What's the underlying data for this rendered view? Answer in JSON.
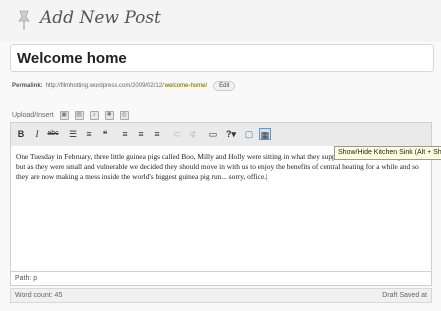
{
  "header": {
    "title": "Add New Post",
    "icon": "pushpin-icon"
  },
  "post": {
    "title": "Welcome home",
    "permalink_label": "Permalink:",
    "permalink_url": "http://filmhotting.wordpress.com/2009/02/12/",
    "permalink_slug": "welcome-home/",
    "edit_label": "Edit"
  },
  "upload": {
    "label": "Upload/Insert",
    "icons": [
      "image-icon",
      "video-icon",
      "music-icon",
      "media-icon",
      "gallery-icon"
    ]
  },
  "toolbar": {
    "bold": "B",
    "italic": "I",
    "strike": "abc",
    "icons": [
      "bold-icon",
      "italic-icon",
      "strikethrough-icon",
      "bullet-list-icon",
      "numbered-list-icon",
      "blockquote-icon",
      "align-left-icon",
      "align-center-icon",
      "align-right-icon",
      "link-icon",
      "unlink-icon",
      "more-tag-icon",
      "spellcheck-icon",
      "fullscreen-icon",
      "kitchen-sink-icon"
    ],
    "tooltip": "Show/Hide Kitchen Sink (Alt + Shift + Z)"
  },
  "editor": {
    "content": "One Tuesday in February, three little guinea pigs called Boo, Milly and Holly were sitting in what they supposed to arrive in our garden, but as they were small and vulnerable we decided they should move in with us to enjoy the benefits of central heating for a while and so they are now making a mess inside the world's biggest guinea pig run... sorry, office.|"
  },
  "status": {
    "path": "Path: p",
    "word_count": "Word count: 45",
    "draft": "Draft Saved at"
  }
}
